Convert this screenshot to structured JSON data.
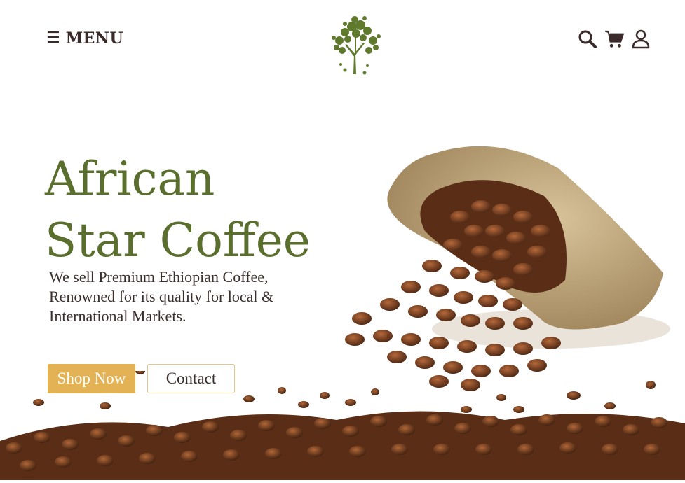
{
  "header": {
    "menu_label": "MENU",
    "menu_icon": "hamburger-icon",
    "logo_icon": "tree-logo-icon",
    "icons": [
      "search-icon",
      "cart-icon",
      "user-icon"
    ]
  },
  "hero": {
    "title": "African Star Coffee",
    "subtitle": "We sell Premium Ethiopian Coffee, Renowned for its quality for local & International Markets.",
    "shop_button": "Shop Now",
    "contact_button": "Contact"
  },
  "colors": {
    "brand_green": "#5a6e2e",
    "accent_gold": "#e2b254",
    "text_dark": "#3a2f2d"
  }
}
